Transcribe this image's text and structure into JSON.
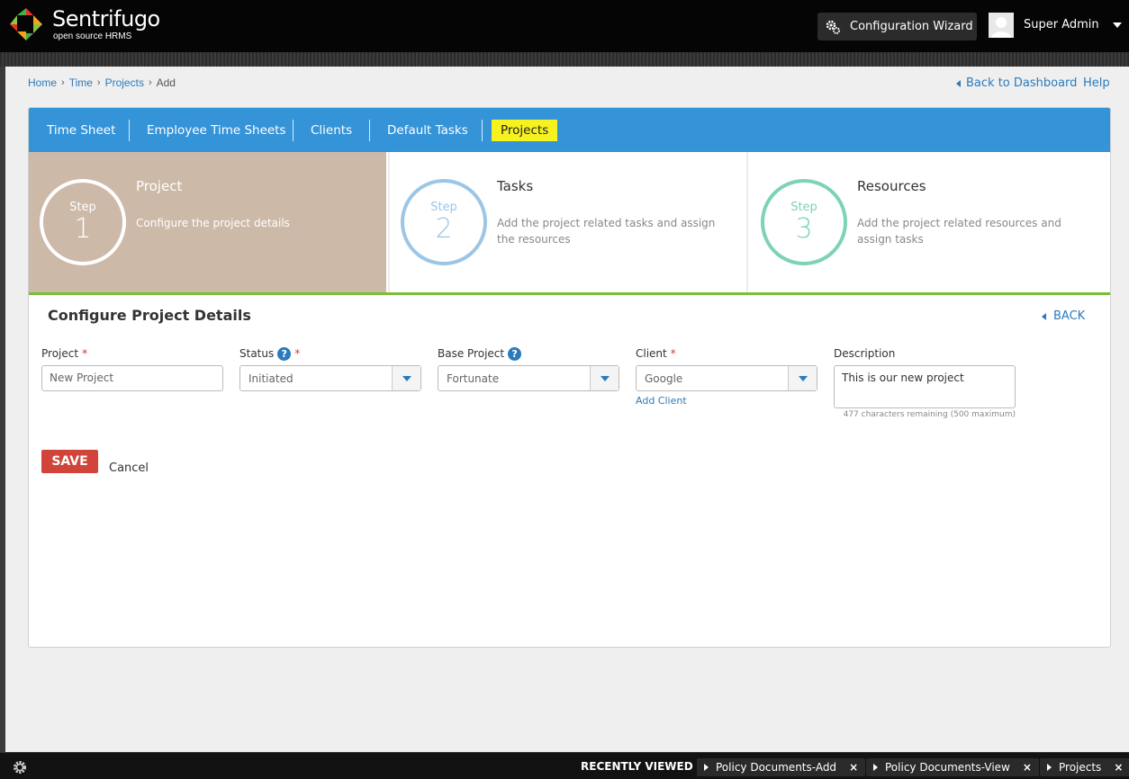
{
  "header": {
    "brand": "Sentrifugo",
    "brand_sub": "open source HRMS",
    "wizard_label": "Configuration Wizard",
    "user_name": "Super Admin"
  },
  "breadcrumb": {
    "home": "Home",
    "time": "Time",
    "projects": "Projects",
    "current": "Add"
  },
  "top_links": {
    "back_to_dashboard": "Back to Dashboard",
    "help": "Help"
  },
  "tabs": [
    {
      "label": "Time Sheet"
    },
    {
      "label": "Employee Time Sheets"
    },
    {
      "label": "Clients"
    },
    {
      "label": "Default Tasks"
    },
    {
      "label": "Projects",
      "active": true
    }
  ],
  "steps": [
    {
      "step_label": "Step",
      "number": "1",
      "title": "Project",
      "description": "Configure the project details"
    },
    {
      "step_label": "Step",
      "number": "2",
      "title": "Tasks",
      "description": "Add the project related tasks and assign the resources"
    },
    {
      "step_label": "Step",
      "number": "3",
      "title": "Resources",
      "description": "Add the project related resources and assign tasks"
    }
  ],
  "form": {
    "title": "Configure Project Details",
    "back_label": "BACK",
    "project_label": "Project",
    "project_placeholder": "New Project",
    "status_label": "Status",
    "status_value": "Initiated",
    "base_project_label": "Base Project",
    "base_project_value": "Fortunate",
    "client_label": "Client",
    "client_value": "Google",
    "add_client": "Add Client",
    "description_label": "Description",
    "description_value": "This is our new project",
    "chars_remaining": "477 characters remaining (500 maximum)",
    "required_mark": "*",
    "help_mark": "?",
    "save_label": "SAVE",
    "cancel_label": "Cancel"
  },
  "footer": {
    "recently_viewed": "RECENTLY VIEWED",
    "items": [
      {
        "label": "Policy Documents-Add"
      },
      {
        "label": "Policy Documents-View"
      },
      {
        "label": "Projects"
      }
    ],
    "close_glyph": "×"
  },
  "colors": {
    "tab_bar": "#3593d8",
    "active_tab": "#f6f21f",
    "step1_bg": "#cdb9a8",
    "save": "#d0443a",
    "progress_line": "#7cbd3a"
  }
}
